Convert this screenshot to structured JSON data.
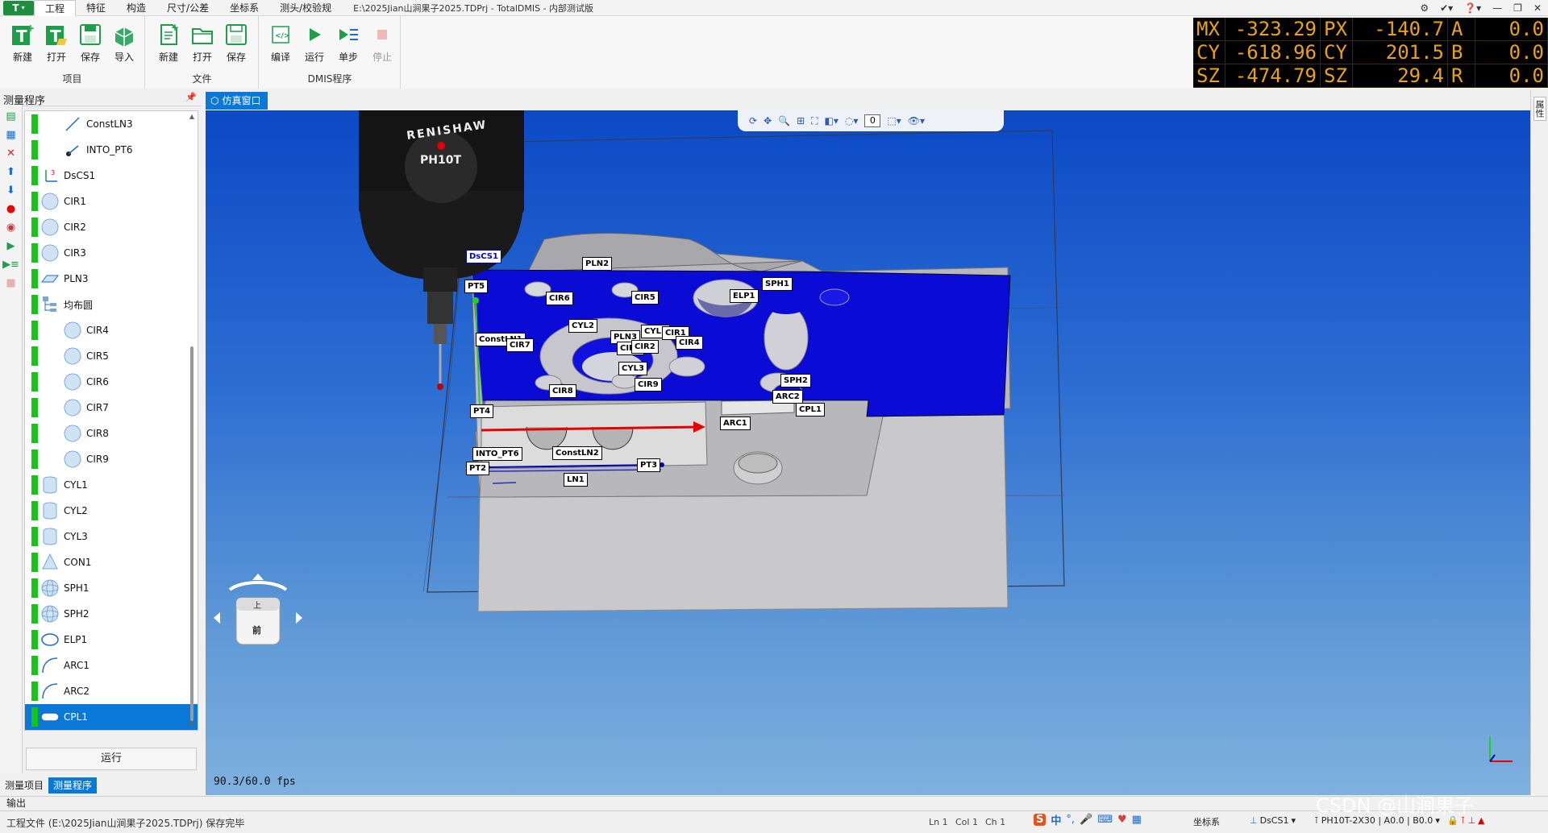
{
  "menubar": {
    "app_label": "T",
    "tabs": [
      "工程",
      "特征",
      "构造",
      "尺寸/公差",
      "坐标系",
      "测头/校验规"
    ],
    "title": "E:\\2025Jian山涧果子2025.TDPrj - TotalDMIS - 内部测试版"
  },
  "ribbon": {
    "project": {
      "label": "项目",
      "new": "新建",
      "open": "打开",
      "save": "保存",
      "import": "导入"
    },
    "file": {
      "label": "文件",
      "new": "新建",
      "open": "打开",
      "save": "保存"
    },
    "dmis": {
      "label": "DMIS程序",
      "compile": "编译",
      "run": "运行",
      "step": "单步",
      "stop": "停止"
    }
  },
  "dro": [
    {
      "axis": "MX",
      "value": "-323.29",
      "axis2": "PX",
      "value2": "-140.7",
      "axis3": "A",
      "value3": "0.0"
    },
    {
      "axis": "CY",
      "value": "-618.96",
      "axis2": "CY",
      "value2": "201.5",
      "axis3": "B",
      "value3": "0.0"
    },
    {
      "axis": "SZ",
      "value": "-474.79",
      "axis2": "SZ",
      "value2": "29.4",
      "axis3": "R",
      "value3": "0.0"
    }
  ],
  "left_panel": {
    "title": "测量程序",
    "items": [
      {
        "label": "ConstLN3",
        "indent": true,
        "icon": "line"
      },
      {
        "label": "INTO_PT6",
        "indent": true,
        "icon": "point-vector"
      },
      {
        "label": "DsCS1",
        "indent": false,
        "icon": "coordinate"
      },
      {
        "label": "CIR1",
        "indent": false,
        "icon": "circle"
      },
      {
        "label": "CIR2",
        "indent": false,
        "icon": "circle"
      },
      {
        "label": "CIR3",
        "indent": false,
        "icon": "circle"
      },
      {
        "label": "PLN3",
        "indent": false,
        "icon": "plane"
      },
      {
        "label": "均布圆",
        "indent": false,
        "icon": "pattern"
      },
      {
        "label": "CIR4",
        "indent": true,
        "icon": "circle"
      },
      {
        "label": "CIR5",
        "indent": true,
        "icon": "circle"
      },
      {
        "label": "CIR6",
        "indent": true,
        "icon": "circle"
      },
      {
        "label": "CIR7",
        "indent": true,
        "icon": "circle"
      },
      {
        "label": "CIR8",
        "indent": true,
        "icon": "circle"
      },
      {
        "label": "CIR9",
        "indent": true,
        "icon": "circle"
      },
      {
        "label": "CYL1",
        "indent": false,
        "icon": "cylinder"
      },
      {
        "label": "CYL2",
        "indent": false,
        "icon": "cylinder"
      },
      {
        "label": "CYL3",
        "indent": false,
        "icon": "cylinder"
      },
      {
        "label": "CON1",
        "indent": false,
        "icon": "cone"
      },
      {
        "label": "SPH1",
        "indent": false,
        "icon": "sphere"
      },
      {
        "label": "SPH2",
        "indent": false,
        "icon": "sphere"
      },
      {
        "label": "ELP1",
        "indent": false,
        "icon": "ellipse"
      },
      {
        "label": "ARC1",
        "indent": false,
        "icon": "arc"
      },
      {
        "label": "ARC2",
        "indent": false,
        "icon": "arc"
      },
      {
        "label": "CPL1",
        "indent": false,
        "icon": "slot",
        "selected": true
      }
    ],
    "run_button": "运行",
    "bottom_tabs": [
      "测量项目",
      "测量程序"
    ]
  },
  "viewport": {
    "tab": "仿真窗口",
    "toolbar_value": "0",
    "fps": "90.3/60.0 fps",
    "nav_cube": {
      "top": "上",
      "front": "前"
    },
    "probe_brand": "RENISHAW",
    "probe_model": "PH10T",
    "labels": [
      "DsCS1",
      "PT5",
      "PLN2",
      "CIR6",
      "CIR5",
      "SPH1",
      "ELP1",
      "CYL2",
      "ConstLN1",
      "CIR7",
      "PLN3",
      "CIR3",
      "CYL1",
      "CIR2",
      "CIR1",
      "CIR4",
      "CYL3",
      "CIR8",
      "CIR9",
      "SPH2",
      "ARC2",
      "PT4",
      "CPL1",
      "ARC1",
      "INTO_PT6",
      "ConstLN2",
      "PT3",
      "PT2",
      "LN1"
    ]
  },
  "right_strip": {
    "label": "属性"
  },
  "output": {
    "label": "输出"
  },
  "status": {
    "message": "工程文件 (E:\\2025Jian山涧果子2025.TDPrj) 保存完毕",
    "ln": "Ln 1",
    "col": "Col 1",
    "ch": "Ch 1",
    "coord_label": "坐标系",
    "coord_value": "DsCS1",
    "probe_value": "PH10T-2X30 | A0.0 | B0.0"
  },
  "watermark": "CSDN @山涧果子",
  "colors": {
    "accent": "#0a78d7",
    "run_green": "#16c516",
    "dro_text": "#e8a317",
    "part_blue": "#0a0bd8"
  }
}
